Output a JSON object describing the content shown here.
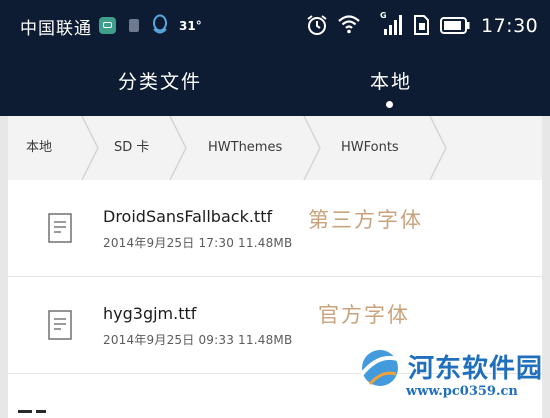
{
  "status_bar": {
    "carrier": "中国联通",
    "temperature": "31°",
    "time": "17:30"
  },
  "tabs": [
    {
      "label": "分类文件",
      "active": false
    },
    {
      "label": "本地",
      "active": true
    }
  ],
  "breadcrumb": [
    "本地",
    "SD 卡",
    "HWThemes",
    "HWFonts"
  ],
  "files": [
    {
      "name": "DroidSansFallback.ttf",
      "meta": "2014年9月25日 17:30 11.48MB",
      "annotation": "第三方字体"
    },
    {
      "name": "hyg3gjm.ttf",
      "meta": "2014年9月25日 09:33 11.48MB",
      "annotation": "官方字体"
    }
  ],
  "watermark": {
    "name": "河东软件园",
    "url": "www.pc0359.cn"
  },
  "colors": {
    "header_bg": "#0e1c33",
    "breadcrumb_bg": "#f3f3f3",
    "annotation": "#c9a37c",
    "watermark": "#1f6fbd"
  },
  "icons": {
    "status_left": [
      "app-notification-icon",
      "sim-icon",
      "qq-icon"
    ],
    "status_right": [
      "alarm-icon",
      "wifi-icon",
      "signal-icon",
      "sim-card-icon",
      "battery-icon"
    ],
    "file": "document-icon"
  }
}
